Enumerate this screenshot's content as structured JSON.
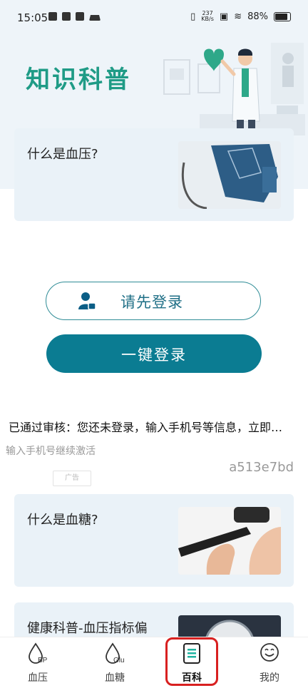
{
  "status_bar": {
    "time": "15:05",
    "net_speed_value": "237",
    "net_speed_unit": "KB/s",
    "battery": "88%"
  },
  "hero": {
    "title": "知识科普"
  },
  "articles": [
    {
      "title": "什么是血压?"
    },
    {
      "title": "什么是血糖?"
    },
    {
      "title": "健康科普-血压指标偏"
    }
  ],
  "login": {
    "first_label": "请先登录",
    "one_click_label": "一键登录"
  },
  "notice": {
    "text": "已通过审核：您还未登录，输入手机号等信息，立即…",
    "hint": "输入手机号继续激活",
    "ad_badge": "广告",
    "ad_code": "a513e7bd"
  },
  "tabs": [
    {
      "label": "血压",
      "icon": "drop-bp-icon",
      "badge": "BP"
    },
    {
      "label": "血糖",
      "icon": "drop-glu-icon",
      "badge": "Glu"
    },
    {
      "label": "百科",
      "icon": "clipboard-icon",
      "active": true
    },
    {
      "label": "我的",
      "icon": "smile-icon"
    }
  ],
  "colors": {
    "accent": "#0b7c92",
    "title_green": "#1f9b86",
    "card_bg": "#eaf2f8",
    "highlight": "#d82020"
  }
}
